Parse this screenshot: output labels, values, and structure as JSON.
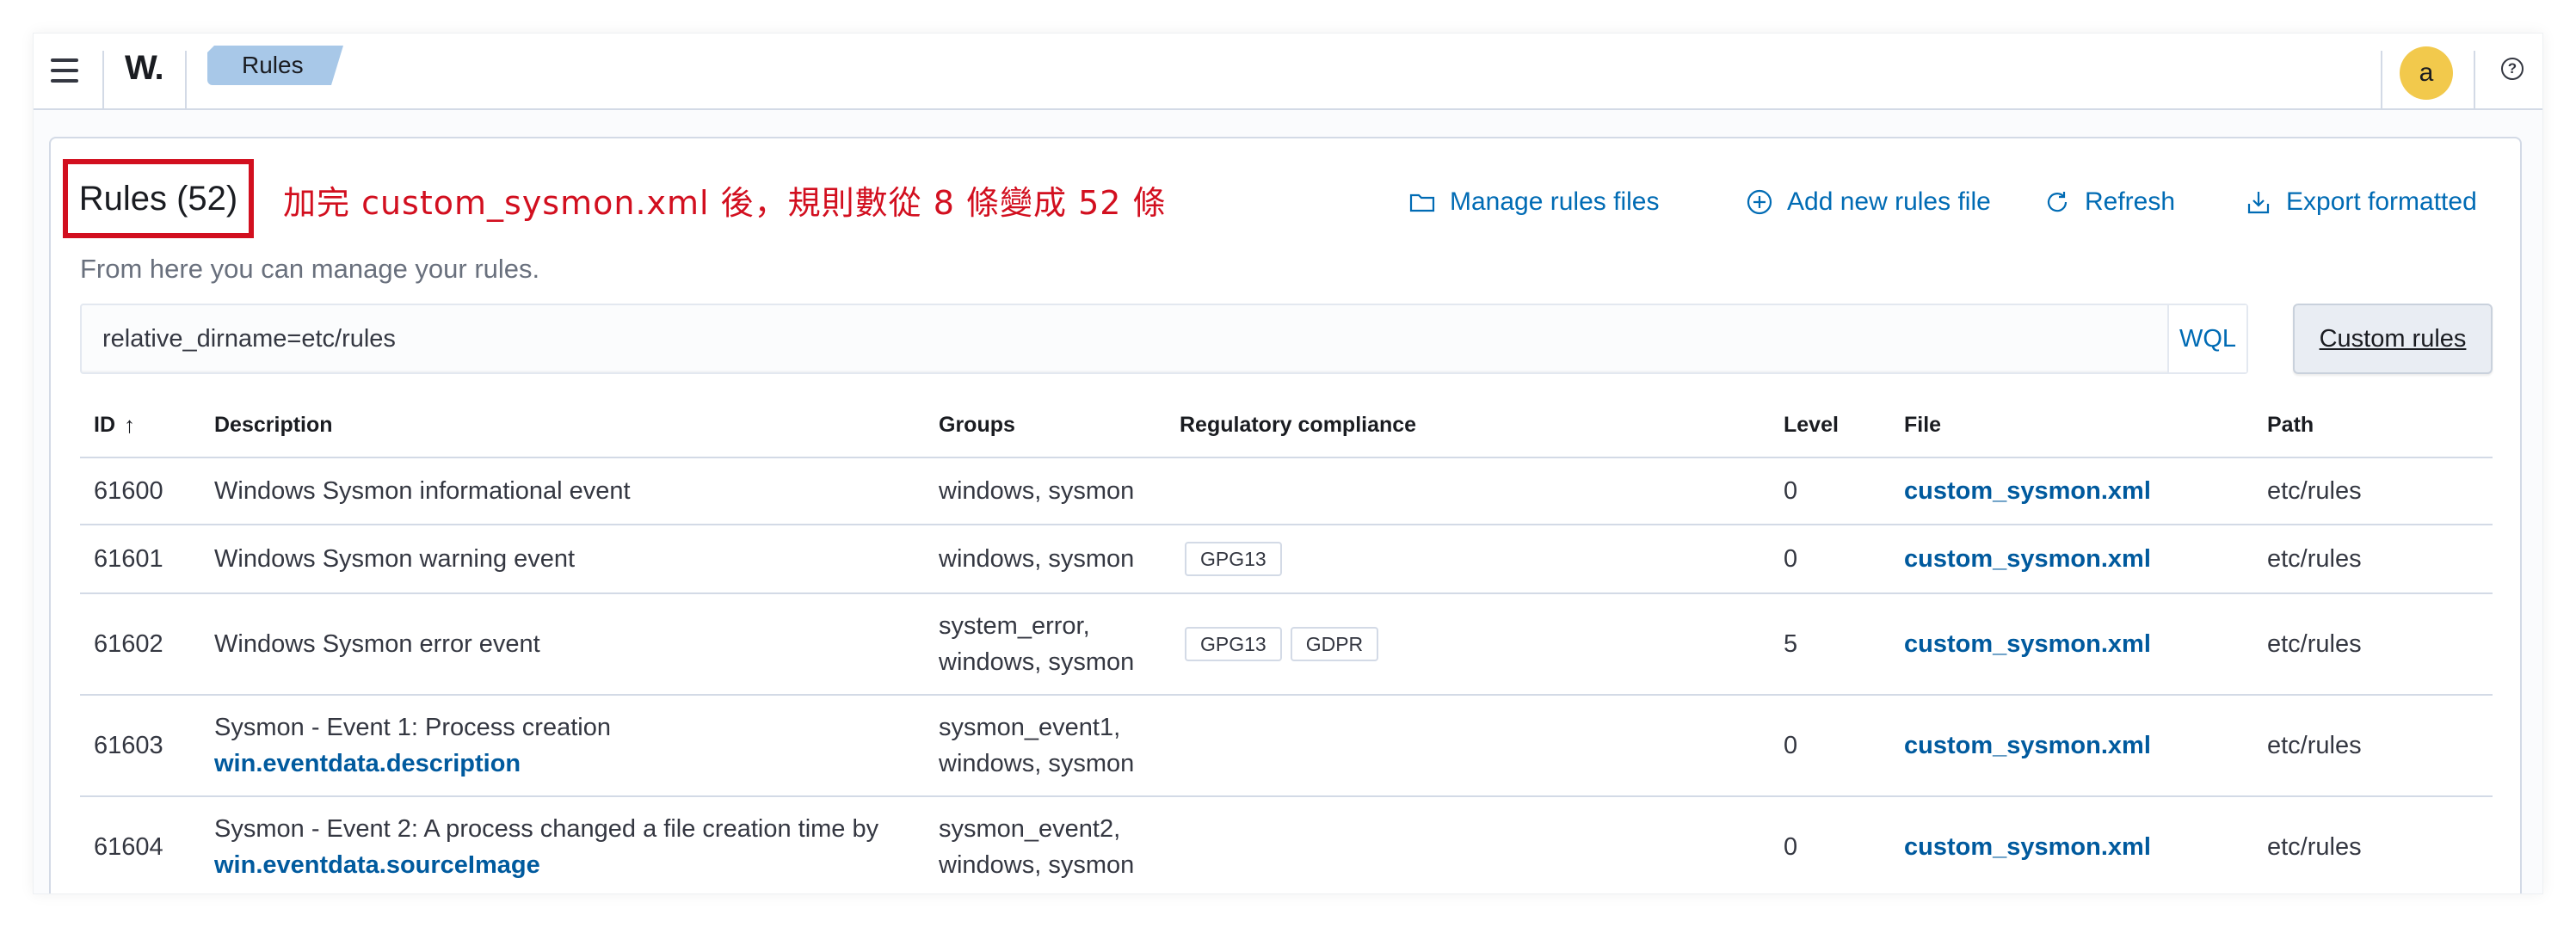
{
  "header": {
    "logo": "W.",
    "breadcrumb": "Rules",
    "avatar_initial": "a",
    "help_glyph": "?"
  },
  "page": {
    "title": "Rules (52)",
    "annotation": "加完 custom_sysmon.xml 後，規則數從 8 條變成 52 條",
    "subtitle": "From here you can manage your rules.",
    "actions": [
      {
        "label": "Manage rules files",
        "icon": "folder-icon"
      },
      {
        "label": "Add new rules file",
        "icon": "plus-circle-icon"
      },
      {
        "label": "Refresh",
        "icon": "refresh-icon"
      },
      {
        "label": "Export formatted",
        "icon": "export-icon"
      }
    ]
  },
  "search": {
    "value": "relative_dirname=etc/rules",
    "language_label": "WQL"
  },
  "custom_rules_button": "Custom rules",
  "table": {
    "columns": [
      "ID",
      "Description",
      "Groups",
      "Regulatory compliance",
      "Level",
      "File",
      "Path"
    ],
    "sort": {
      "column": "ID",
      "direction": "ascending"
    },
    "rows": [
      {
        "id": "61600",
        "description": "Windows Sysmon informational event",
        "description_field": "",
        "groups_line1": "windows, sysmon",
        "groups_line2": "",
        "compliance": [],
        "level": "0",
        "file": "custom_sysmon.xml",
        "path": "etc/rules"
      },
      {
        "id": "61601",
        "description": "Windows Sysmon warning event",
        "description_field": "",
        "groups_line1": "windows, sysmon",
        "groups_line2": "",
        "compliance": [
          "GPG13"
        ],
        "level": "0",
        "file": "custom_sysmon.xml",
        "path": "etc/rules"
      },
      {
        "id": "61602",
        "description": "Windows Sysmon error event",
        "description_field": "",
        "groups_line1": "system_error,",
        "groups_line2": "windows, sysmon",
        "compliance": [
          "GPG13",
          "GDPR"
        ],
        "level": "5",
        "file": "custom_sysmon.xml",
        "path": "etc/rules"
      },
      {
        "id": "61603",
        "description": "Sysmon - Event 1: Process creation",
        "description_field": "win.eventdata.description",
        "groups_line1": "sysmon_event1,",
        "groups_line2": "windows, sysmon",
        "compliance": [],
        "level": "0",
        "file": "custom_sysmon.xml",
        "path": "etc/rules"
      },
      {
        "id": "61604",
        "description": "Sysmon - Event 2: A process changed a file creation time by",
        "description_field": "win.eventdata.sourceImage",
        "groups_line1": "sysmon_event2,",
        "groups_line2": "windows, sysmon",
        "compliance": [],
        "level": "0",
        "file": "custom_sysmon.xml",
        "path": "etc/rules"
      }
    ]
  },
  "colors": {
    "link": "#006bb4",
    "annotation_red": "#d20f1f",
    "breadcrumb_bg": "#a8c8e8",
    "avatar_bg": "#f2c94c"
  }
}
